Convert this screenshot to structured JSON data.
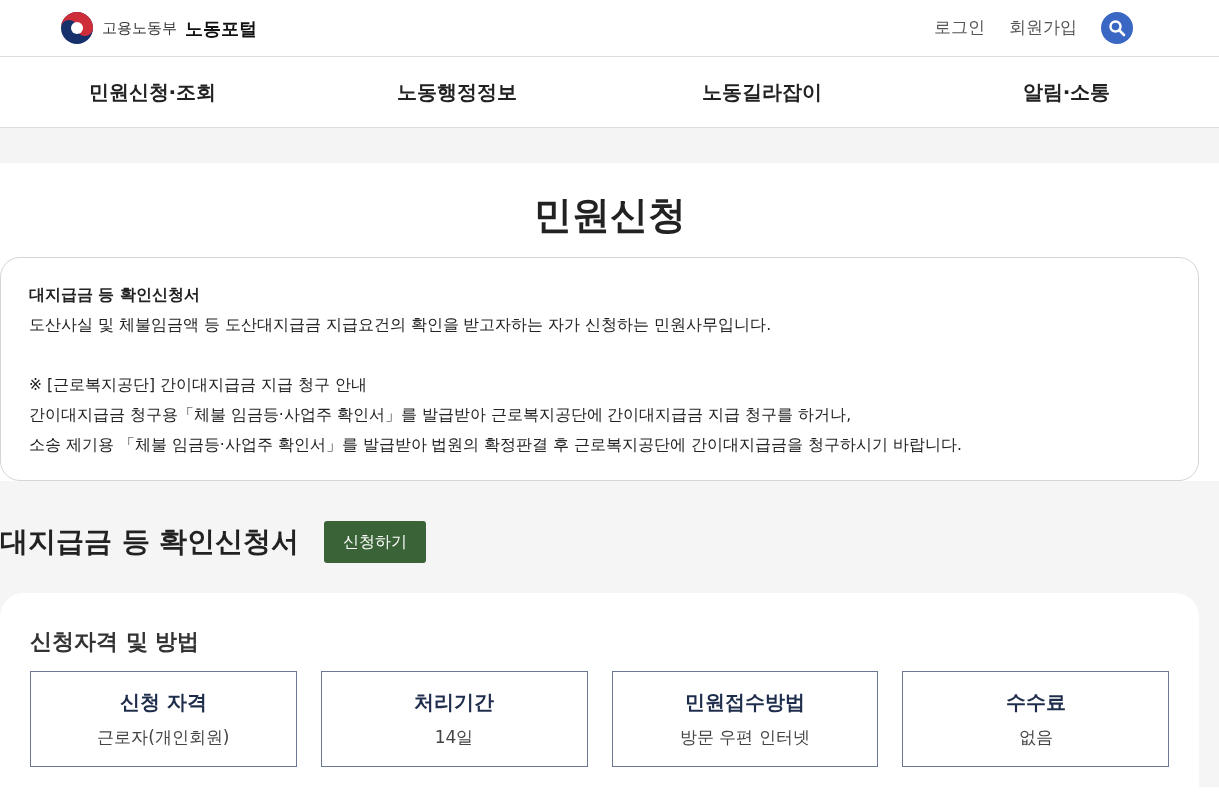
{
  "header": {
    "ministry": "고용노동부",
    "portal": "노동포털",
    "links": [
      "로그인",
      "회원가입"
    ]
  },
  "nav": [
    "민원신청·조회",
    "노동행정정보",
    "노동길라잡이",
    "알림·소통"
  ],
  "page_title": "민원신청",
  "notice": {
    "title": "대지급금 등 확인신청서",
    "paragraphs": [
      [
        "도산사실 및 체불임금액 등 도산대지급금 지급요건의 확인을 받고자하는 자가 신청하는 민원사무입니다."
      ],
      [
        "※ [근로복지공단] 간이대지급금 지급 청구 안내",
        "간이대지급금 청구용「체불 임금등·사업주 확인서」를 발급받아 근로복지공단에 간이대지급금 지급 청구를 하거나,",
        "소송 제기용 「체불 임금등·사업주 확인서」를 발급받아 법원의 확정판결 후 근로복지공단에 간이대지급금을 청구하시기 바랍니다."
      ]
    ]
  },
  "form": {
    "title": "대지급금 등 확인신청서",
    "apply_button": "신청하기"
  },
  "eligibility": {
    "title": "신청자격 및 방법",
    "items": [
      {
        "label": "신청 자격",
        "value": "근로자(개인회원)"
      },
      {
        "label": "처리기간",
        "value": "14일"
      },
      {
        "label": "민원접수방법",
        "value": "방문 우편 인터넷"
      },
      {
        "label": "수수료",
        "value": "없음"
      }
    ]
  }
}
